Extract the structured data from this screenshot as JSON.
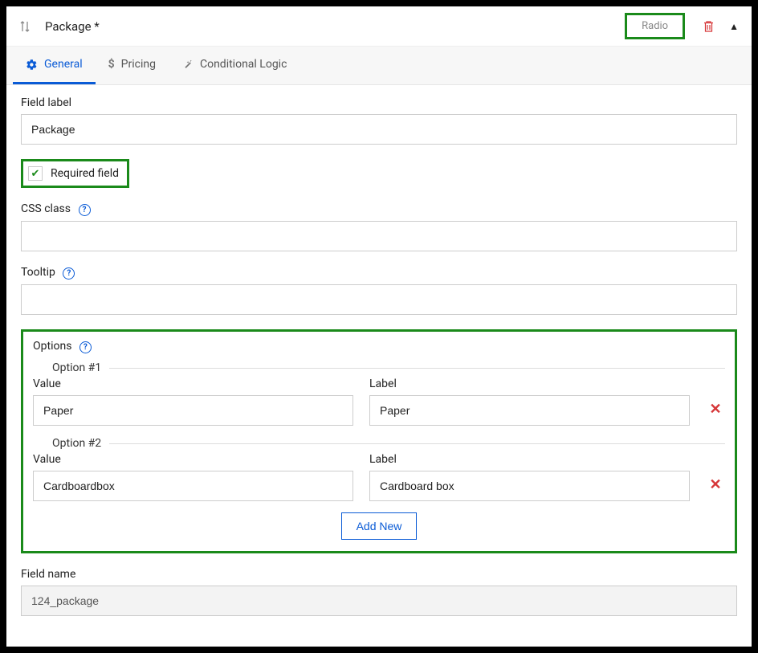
{
  "header": {
    "title": "Package *",
    "type_badge": "Radio"
  },
  "tabs": {
    "general": "General",
    "pricing": "Pricing",
    "conditional": "Conditional Logic"
  },
  "general": {
    "field_label_caption": "Field label",
    "field_label_value": "Package",
    "required_label": "Required field",
    "css_class_caption": "CSS class",
    "css_class_value": "",
    "tooltip_caption": "Tooltip",
    "tooltip_value": "",
    "options_caption": "Options",
    "value_caption": "Value",
    "label_caption": "Label",
    "option1_legend": "Option #1",
    "option1_value": "Paper",
    "option1_label": "Paper",
    "option2_legend": "Option #2",
    "option2_value": "Cardboardbox",
    "option2_label": "Cardboard box",
    "add_new": "Add New",
    "field_name_caption": "Field name",
    "field_name_value": "124_package"
  }
}
